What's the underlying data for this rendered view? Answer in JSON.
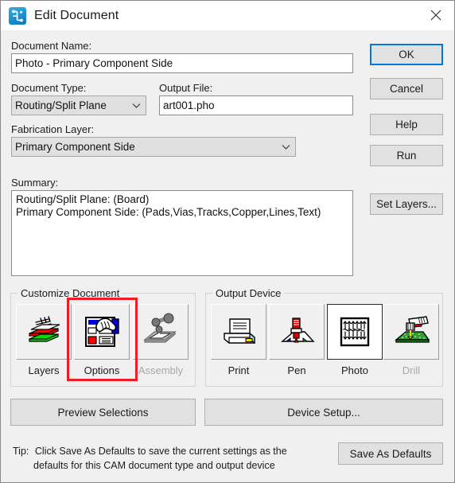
{
  "window": {
    "title": "Edit Document",
    "app_icon": "circuit-trace-icon",
    "close_icon": "close-icon"
  },
  "form": {
    "document_name_label": "Document Name:",
    "document_name_value": "Photo - Primary Component Side",
    "document_type_label": "Document Type:",
    "document_type_value": "Routing/Split Plane",
    "output_file_label": "Output File:",
    "output_file_value": "art001.pho",
    "fabrication_layer_label": "Fabrication Layer:",
    "fabrication_layer_value": "Primary Component Side",
    "summary_label": "Summary:",
    "summary_lines": [
      "Routing/Split Plane: (Board)",
      "Primary Component Side: (Pads,Vias,Tracks,Copper,Lines,Text)"
    ]
  },
  "side_buttons": {
    "ok": "OK",
    "cancel": "Cancel",
    "help": "Help",
    "run": "Run",
    "set_layers": "Set Layers..."
  },
  "customize_document": {
    "group_title": "Customize Document",
    "items": [
      {
        "label": "Layers",
        "icon": "layer-stack-icon",
        "state": "enabled"
      },
      {
        "label": "Options",
        "icon": "hand-document-icon",
        "state": "enabled"
      },
      {
        "label": "Assembly",
        "icon": "robot-arm-icon",
        "state": "disabled"
      }
    ],
    "highlighted_item": "Options"
  },
  "output_device": {
    "group_title": "Output Device",
    "items": [
      {
        "label": "Print",
        "icon": "printer-icon",
        "state": "enabled"
      },
      {
        "label": "Pen",
        "icon": "pen-plotter-icon",
        "state": "enabled"
      },
      {
        "label": "Photo",
        "icon": "photoplotter-icon",
        "state": "selected"
      },
      {
        "label": "Drill",
        "icon": "drill-icon",
        "state": "disabled"
      }
    ],
    "selected_item": "Photo"
  },
  "bottom": {
    "preview_selections": "Preview Selections",
    "device_setup": "Device Setup...",
    "save_as_defaults": "Save As Defaults",
    "tip_prefix": "Tip:",
    "tip_line1": "Click Save As Defaults to save the current settings as the",
    "tip_line2": "defaults for this CAM document type and output device"
  },
  "colors": {
    "accent": "#0078d7",
    "dialog_bg": "#f0f0f0",
    "annotation": "#ee1c25",
    "field_bg": "#ffffff",
    "combo_bg": "#e0e0e0",
    "disabled_text": "#a8a8a8"
  }
}
